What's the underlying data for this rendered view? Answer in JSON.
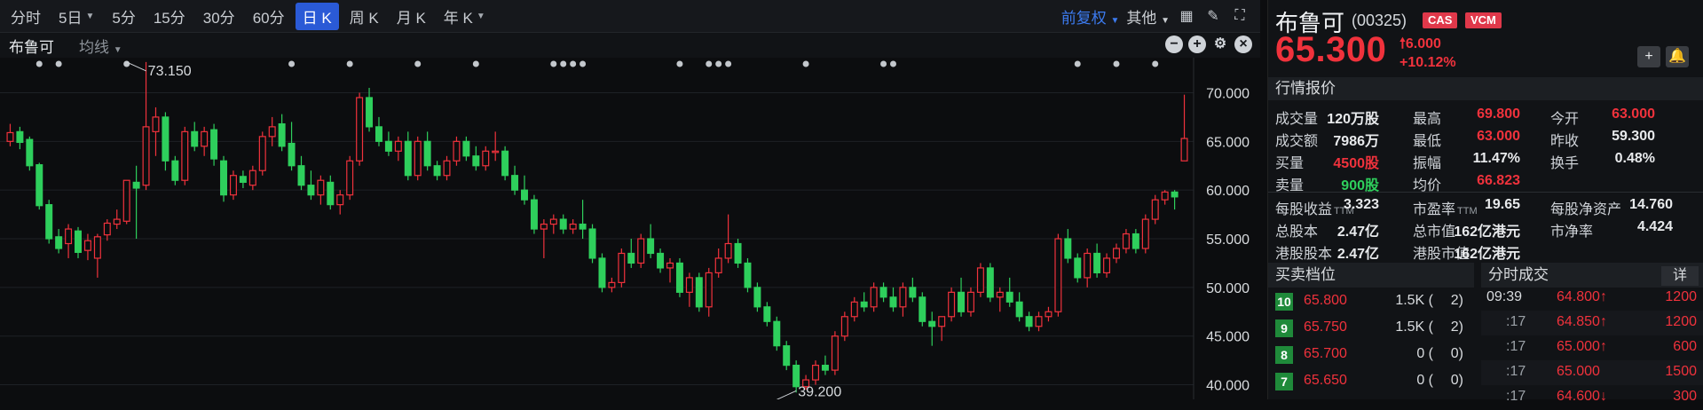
{
  "toolbar": {
    "periods": [
      {
        "label": "分时",
        "active": false,
        "dropdown": false
      },
      {
        "label": "5日",
        "active": false,
        "dropdown": true
      },
      {
        "label": "5分",
        "active": false,
        "dropdown": false
      },
      {
        "label": "15分",
        "active": false,
        "dropdown": false
      },
      {
        "label": "30分",
        "active": false,
        "dropdown": false
      },
      {
        "label": "60分",
        "active": false,
        "dropdown": false
      },
      {
        "label": "日 K",
        "active": true,
        "dropdown": false
      },
      {
        "label": "周 K",
        "active": false,
        "dropdown": false
      },
      {
        "label": "月 K",
        "active": false,
        "dropdown": false
      },
      {
        "label": "年 K",
        "active": false,
        "dropdown": true
      }
    ],
    "adjust": "前复权",
    "other": "其他"
  },
  "chart_header": {
    "name": "布鲁可",
    "ma": "均线"
  },
  "chart_data": {
    "type": "candlestick",
    "y_ticks": [
      "70.000",
      "65.000",
      "60.000",
      "55.000",
      "50.000",
      "45.000",
      "40.000"
    ],
    "ylim": [
      38.5,
      73.6
    ],
    "high_label": "73.150",
    "low_label": "39.200",
    "high_value": 73.15,
    "low_value": 39.2,
    "high_index": 12,
    "low_index": 79,
    "marker_indices": [
      3,
      5,
      12,
      29,
      35,
      42,
      48,
      56,
      57,
      58,
      59,
      69,
      72,
      73,
      74,
      82,
      90,
      91,
      110,
      114,
      118
    ],
    "candles": [
      {
        "o": 65.0,
        "h": 66.8,
        "l": 64.5,
        "c": 65.9
      },
      {
        "o": 66.0,
        "h": 66.5,
        "l": 64.2,
        "c": 64.9
      },
      {
        "o": 65.2,
        "h": 65.5,
        "l": 62.0,
        "c": 62.5
      },
      {
        "o": 62.6,
        "h": 62.8,
        "l": 58.0,
        "c": 58.4
      },
      {
        "o": 58.5,
        "h": 59.0,
        "l": 54.5,
        "c": 55.0
      },
      {
        "o": 55.2,
        "h": 56.0,
        "l": 53.5,
        "c": 54.0
      },
      {
        "o": 54.5,
        "h": 56.5,
        "l": 53.0,
        "c": 56.0
      },
      {
        "o": 55.8,
        "h": 56.2,
        "l": 53.0,
        "c": 53.6
      },
      {
        "o": 53.8,
        "h": 55.5,
        "l": 52.8,
        "c": 54.8
      },
      {
        "o": 53.0,
        "h": 55.5,
        "l": 51.0,
        "c": 55.2
      },
      {
        "o": 55.4,
        "h": 57.0,
        "l": 54.8,
        "c": 56.6
      },
      {
        "o": 56.5,
        "h": 58.0,
        "l": 56.0,
        "c": 57.0
      },
      {
        "o": 56.8,
        "h": 61.0,
        "l": 56.5,
        "c": 61.0
      },
      {
        "o": 60.8,
        "h": 62.5,
        "l": 55.0,
        "c": 60.2
      },
      {
        "o": 60.5,
        "h": 73.15,
        "l": 60.0,
        "c": 66.5
      },
      {
        "o": 66.0,
        "h": 68.5,
        "l": 63.5,
        "c": 67.5
      },
      {
        "o": 67.5,
        "h": 68.0,
        "l": 62.0,
        "c": 63.0
      },
      {
        "o": 63.0,
        "h": 63.5,
        "l": 60.5,
        "c": 61.0
      },
      {
        "o": 61.0,
        "h": 66.5,
        "l": 60.5,
        "c": 66.0
      },
      {
        "o": 66.0,
        "h": 67.0,
        "l": 64.0,
        "c": 64.5
      },
      {
        "o": 64.5,
        "h": 66.5,
        "l": 63.5,
        "c": 66.0
      },
      {
        "o": 66.2,
        "h": 66.8,
        "l": 62.5,
        "c": 63.2
      },
      {
        "o": 63.0,
        "h": 63.5,
        "l": 58.8,
        "c": 59.5
      },
      {
        "o": 59.5,
        "h": 62.0,
        "l": 59.0,
        "c": 61.5
      },
      {
        "o": 61.4,
        "h": 62.0,
        "l": 60.2,
        "c": 60.8
      },
      {
        "o": 60.5,
        "h": 62.5,
        "l": 60.0,
        "c": 62.0
      },
      {
        "o": 62.0,
        "h": 66.0,
        "l": 61.5,
        "c": 65.5
      },
      {
        "o": 65.5,
        "h": 67.5,
        "l": 64.5,
        "c": 66.5
      },
      {
        "o": 66.8,
        "h": 67.8,
        "l": 64.0,
        "c": 64.5
      },
      {
        "o": 64.8,
        "h": 67.0,
        "l": 62.0,
        "c": 62.5
      },
      {
        "o": 62.5,
        "h": 63.5,
        "l": 60.0,
        "c": 60.5
      },
      {
        "o": 60.5,
        "h": 62.0,
        "l": 59.0,
        "c": 59.5
      },
      {
        "o": 59.5,
        "h": 61.5,
        "l": 58.5,
        "c": 61.0
      },
      {
        "o": 60.8,
        "h": 61.5,
        "l": 58.0,
        "c": 58.5
      },
      {
        "o": 58.5,
        "h": 60.0,
        "l": 57.5,
        "c": 59.5
      },
      {
        "o": 59.5,
        "h": 63.5,
        "l": 59.0,
        "c": 63.0
      },
      {
        "o": 63.0,
        "h": 70.0,
        "l": 62.5,
        "c": 69.5
      },
      {
        "o": 69.5,
        "h": 70.5,
        "l": 66.0,
        "c": 66.5
      },
      {
        "o": 66.5,
        "h": 67.5,
        "l": 64.5,
        "c": 65.0
      },
      {
        "o": 65.0,
        "h": 66.0,
        "l": 63.5,
        "c": 64.0
      },
      {
        "o": 64.0,
        "h": 65.5,
        "l": 63.0,
        "c": 65.0
      },
      {
        "o": 65.0,
        "h": 66.0,
        "l": 61.0,
        "c": 61.5
      },
      {
        "o": 61.5,
        "h": 65.5,
        "l": 61.0,
        "c": 65.0
      },
      {
        "o": 65.0,
        "h": 66.0,
        "l": 62.0,
        "c": 62.5
      },
      {
        "o": 62.5,
        "h": 63.0,
        "l": 61.0,
        "c": 61.5
      },
      {
        "o": 61.5,
        "h": 63.5,
        "l": 61.0,
        "c": 63.0
      },
      {
        "o": 63.0,
        "h": 65.5,
        "l": 62.5,
        "c": 65.0
      },
      {
        "o": 65.0,
        "h": 65.5,
        "l": 63.0,
        "c": 63.5
      },
      {
        "o": 63.5,
        "h": 64.5,
        "l": 62.0,
        "c": 62.5
      },
      {
        "o": 62.5,
        "h": 64.5,
        "l": 62.0,
        "c": 64.0
      },
      {
        "o": 64.0,
        "h": 66.0,
        "l": 63.0,
        "c": 64.0
      },
      {
        "o": 64.0,
        "h": 64.5,
        "l": 61.0,
        "c": 61.5
      },
      {
        "o": 61.5,
        "h": 62.5,
        "l": 59.5,
        "c": 60.0
      },
      {
        "o": 60.0,
        "h": 61.5,
        "l": 58.5,
        "c": 59.0
      },
      {
        "o": 59.0,
        "h": 59.5,
        "l": 55.5,
        "c": 56.0
      },
      {
        "o": 56.0,
        "h": 57.0,
        "l": 53.0,
        "c": 56.5
      },
      {
        "o": 56.5,
        "h": 57.5,
        "l": 55.5,
        "c": 57.0
      },
      {
        "o": 57.0,
        "h": 57.5,
        "l": 55.5,
        "c": 56.0
      },
      {
        "o": 56.0,
        "h": 57.0,
        "l": 55.5,
        "c": 56.5
      },
      {
        "o": 56.5,
        "h": 59.0,
        "l": 55.0,
        "c": 56.0
      },
      {
        "o": 56.0,
        "h": 56.5,
        "l": 52.5,
        "c": 53.0
      },
      {
        "o": 53.0,
        "h": 53.5,
        "l": 49.5,
        "c": 50.0
      },
      {
        "o": 50.0,
        "h": 51.0,
        "l": 49.5,
        "c": 50.5
      },
      {
        "o": 50.5,
        "h": 54.0,
        "l": 50.0,
        "c": 53.5
      },
      {
        "o": 53.5,
        "h": 55.0,
        "l": 52.0,
        "c": 52.5
      },
      {
        "o": 52.5,
        "h": 55.5,
        "l": 52.0,
        "c": 55.0
      },
      {
        "o": 55.0,
        "h": 56.5,
        "l": 53.0,
        "c": 53.5
      },
      {
        "o": 53.5,
        "h": 54.0,
        "l": 51.5,
        "c": 52.0
      },
      {
        "o": 52.0,
        "h": 53.0,
        "l": 50.5,
        "c": 52.5
      },
      {
        "o": 52.5,
        "h": 53.0,
        "l": 49.0,
        "c": 49.5
      },
      {
        "o": 49.5,
        "h": 51.5,
        "l": 48.0,
        "c": 51.0
      },
      {
        "o": 51.0,
        "h": 51.5,
        "l": 47.5,
        "c": 48.0
      },
      {
        "o": 48.0,
        "h": 52.0,
        "l": 47.0,
        "c": 51.5
      },
      {
        "o": 51.5,
        "h": 54.0,
        "l": 51.0,
        "c": 53.0
      },
      {
        "o": 53.0,
        "h": 57.5,
        "l": 52.5,
        "c": 54.5
      },
      {
        "o": 54.5,
        "h": 55.0,
        "l": 52.0,
        "c": 52.5
      },
      {
        "o": 52.5,
        "h": 53.0,
        "l": 49.5,
        "c": 50.0
      },
      {
        "o": 50.0,
        "h": 50.5,
        "l": 47.5,
        "c": 48.0
      },
      {
        "o": 48.0,
        "h": 48.5,
        "l": 46.0,
        "c": 46.5
      },
      {
        "o": 46.5,
        "h": 47.0,
        "l": 43.5,
        "c": 44.0
      },
      {
        "o": 44.0,
        "h": 44.5,
        "l": 41.5,
        "c": 42.0
      },
      {
        "o": 42.0,
        "h": 42.5,
        "l": 39.2,
        "c": 39.8
      },
      {
        "o": 39.8,
        "h": 41.0,
        "l": 39.5,
        "c": 40.5
      },
      {
        "o": 40.5,
        "h": 42.5,
        "l": 40.0,
        "c": 42.0
      },
      {
        "o": 42.0,
        "h": 43.0,
        "l": 41.0,
        "c": 41.5
      },
      {
        "o": 41.5,
        "h": 45.5,
        "l": 41.0,
        "c": 45.0
      },
      {
        "o": 45.0,
        "h": 47.5,
        "l": 44.5,
        "c": 47.0
      },
      {
        "o": 47.0,
        "h": 49.0,
        "l": 46.5,
        "c": 48.5
      },
      {
        "o": 48.5,
        "h": 49.5,
        "l": 47.5,
        "c": 48.0
      },
      {
        "o": 48.0,
        "h": 50.5,
        "l": 47.5,
        "c": 50.0
      },
      {
        "o": 50.0,
        "h": 50.5,
        "l": 48.5,
        "c": 49.0
      },
      {
        "o": 49.0,
        "h": 50.0,
        "l": 47.5,
        "c": 48.0
      },
      {
        "o": 48.0,
        "h": 50.5,
        "l": 47.0,
        "c": 50.0
      },
      {
        "o": 50.0,
        "h": 51.0,
        "l": 48.5,
        "c": 49.0
      },
      {
        "o": 49.0,
        "h": 49.5,
        "l": 46.0,
        "c": 46.5
      },
      {
        "o": 46.5,
        "h": 47.5,
        "l": 44.0,
        "c": 46.0
      },
      {
        "o": 46.0,
        "h": 47.0,
        "l": 44.5,
        "c": 47.0
      },
      {
        "o": 47.0,
        "h": 50.0,
        "l": 46.5,
        "c": 49.5
      },
      {
        "o": 49.5,
        "h": 51.0,
        "l": 47.0,
        "c": 47.5
      },
      {
        "o": 47.5,
        "h": 50.0,
        "l": 47.0,
        "c": 49.5
      },
      {
        "o": 49.5,
        "h": 52.5,
        "l": 49.0,
        "c": 52.0
      },
      {
        "o": 52.0,
        "h": 52.5,
        "l": 48.5,
        "c": 49.0
      },
      {
        "o": 49.0,
        "h": 50.0,
        "l": 47.5,
        "c": 49.5
      },
      {
        "o": 49.5,
        "h": 51.0,
        "l": 48.0,
        "c": 48.5
      },
      {
        "o": 48.5,
        "h": 49.5,
        "l": 46.5,
        "c": 47.0
      },
      {
        "o": 47.0,
        "h": 47.5,
        "l": 45.5,
        "c": 46.0
      },
      {
        "o": 46.0,
        "h": 47.5,
        "l": 45.5,
        "c": 47.0
      },
      {
        "o": 47.0,
        "h": 48.0,
        "l": 46.5,
        "c": 47.5
      },
      {
        "o": 47.5,
        "h": 55.5,
        "l": 47.0,
        "c": 55.0
      },
      {
        "o": 55.0,
        "h": 56.0,
        "l": 52.5,
        "c": 53.0
      },
      {
        "o": 53.0,
        "h": 53.5,
        "l": 50.5,
        "c": 51.0
      },
      {
        "o": 51.0,
        "h": 54.0,
        "l": 50.0,
        "c": 53.5
      },
      {
        "o": 53.5,
        "h": 54.5,
        "l": 51.0,
        "c": 51.5
      },
      {
        "o": 51.5,
        "h": 53.5,
        "l": 51.0,
        "c": 53.0
      },
      {
        "o": 53.0,
        "h": 54.5,
        "l": 52.5,
        "c": 54.0
      },
      {
        "o": 54.0,
        "h": 56.0,
        "l": 53.5,
        "c": 55.5
      },
      {
        "o": 55.5,
        "h": 56.0,
        "l": 53.5,
        "c": 54.0
      },
      {
        "o": 54.0,
        "h": 57.5,
        "l": 53.5,
        "c": 57.0
      },
      {
        "o": 57.0,
        "h": 59.5,
        "l": 56.5,
        "c": 59.0
      },
      {
        "o": 59.0,
        "h": 60.0,
        "l": 58.5,
        "c": 59.8
      },
      {
        "o": 59.8,
        "h": 60.0,
        "l": 58.0,
        "c": 59.3
      },
      {
        "o": 63.0,
        "h": 69.8,
        "l": 63.0,
        "c": 65.3
      }
    ]
  },
  "quote": {
    "name": "布鲁可",
    "code": "(00325)",
    "badges": [
      "CAS",
      "VCM"
    ],
    "price": "65.300",
    "change": "6.000",
    "change_pct": "+10.12%",
    "section_title": "行情报价",
    "rows": [
      [
        {
          "l": "成交量",
          "v": "120万股",
          "c": ""
        },
        {
          "l": "最高",
          "v": "69.800",
          "c": "red"
        },
        {
          "l": "今开",
          "v": "63.000",
          "c": "red"
        }
      ],
      [
        {
          "l": "成交额",
          "v": "7986万",
          "c": ""
        },
        {
          "l": "最低",
          "v": "63.000",
          "c": "red"
        },
        {
          "l": "昨收",
          "v": "59.300",
          "c": ""
        }
      ],
      [
        {
          "l": "买量",
          "v": "4500股",
          "c": "red"
        },
        {
          "l": "振幅",
          "v": "11.47%",
          "c": ""
        },
        {
          "l": "换手",
          "v": "0.48%",
          "c": ""
        }
      ],
      [
        {
          "l": "卖量",
          "v": "900股",
          "c": "green"
        },
        {
          "l": "均价",
          "v": "66.823",
          "c": "red"
        },
        {
          "l": "",
          "v": "",
          "c": ""
        }
      ]
    ],
    "rows2": [
      [
        {
          "l": "每股收益",
          "ttm": "TTM",
          "v": "3.323"
        },
        {
          "l": "市盈率",
          "ttm": "TTM",
          "v": "19.65"
        },
        {
          "l": "每股净资产",
          "ttm": "",
          "v": "14.760"
        }
      ],
      [
        {
          "l": "总股本",
          "ttm": "",
          "v": "2.47亿"
        },
        {
          "l": "总市值",
          "ttm": "",
          "v": "162亿港元"
        },
        {
          "l": "市净率",
          "ttm": "",
          "v": "4.424"
        }
      ],
      [
        {
          "l": "港股股本",
          "ttm": "",
          "v": "2.47亿"
        },
        {
          "l": "港股市值",
          "ttm": "",
          "v": "162亿港元"
        },
        {
          "l": "",
          "ttm": "",
          "v": ""
        }
      ]
    ]
  },
  "orderbook": {
    "title": "买卖档位",
    "levels": [
      {
        "lvl": "10",
        "price": "65.800",
        "vol": "1.5K (",
        "cnt": "2)"
      },
      {
        "lvl": "9",
        "price": "65.750",
        "vol": "1.5K (",
        "cnt": "2)"
      },
      {
        "lvl": "8",
        "price": "65.700",
        "vol": "0 (",
        "cnt": "0)"
      },
      {
        "lvl": "7",
        "price": "65.650",
        "vol": "0 (",
        "cnt": "0)"
      }
    ]
  },
  "trades": {
    "title": "分时成交",
    "detail": "详",
    "rows": [
      {
        "t": "09:39",
        "p": "64.800↑",
        "q": "1200"
      },
      {
        "t": ":17",
        "p": "64.850↑",
        "q": "1200"
      },
      {
        "t": ":17",
        "p": "65.000↑",
        "q": "600"
      },
      {
        "t": ":17",
        "p": "65.000",
        "q": "1500"
      },
      {
        "t": ":17",
        "p": "64.600↓",
        "q": "300"
      }
    ]
  }
}
